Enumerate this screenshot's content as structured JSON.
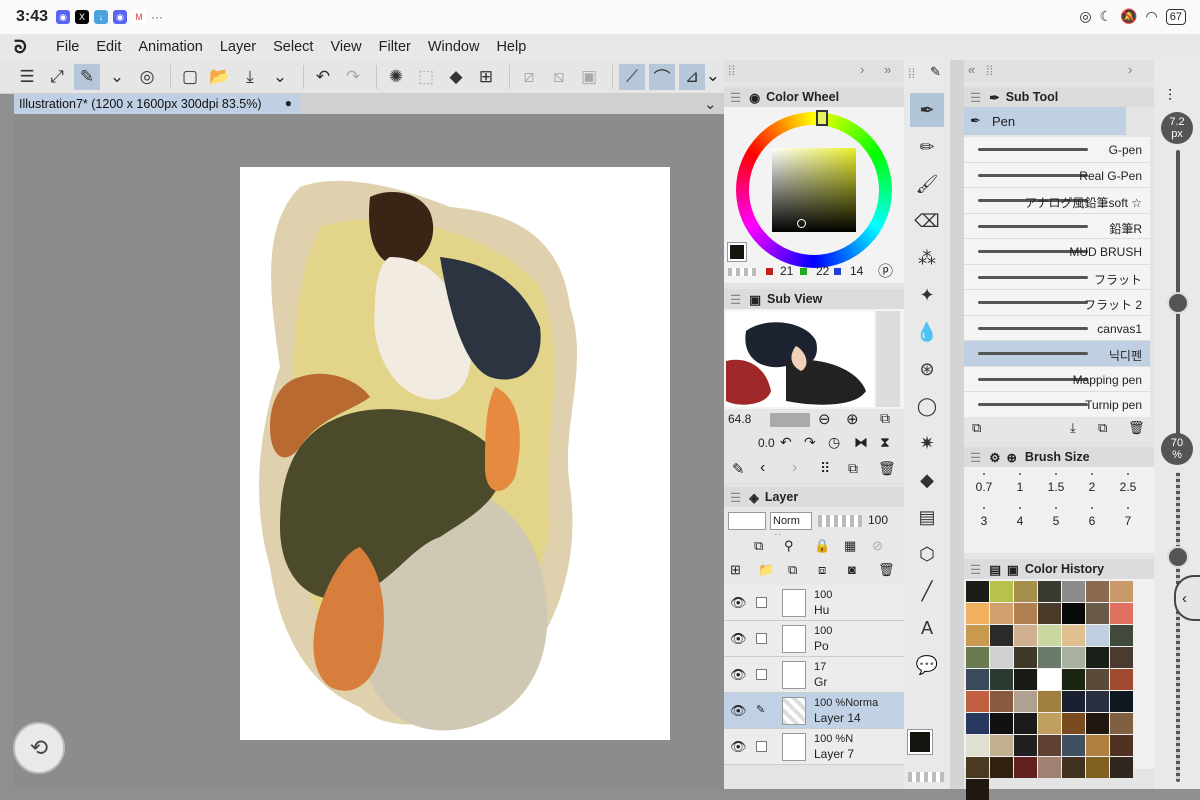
{
  "status": {
    "time": "3:43",
    "battery": "67"
  },
  "menu": [
    "File",
    "Edit",
    "Animation",
    "Layer",
    "Select",
    "View",
    "Filter",
    "Window",
    "Help"
  ],
  "document_tab": "Illustration7* (1200 x 1600px 300dpi 83.5%)",
  "color_wheel": {
    "title": "Color Wheel",
    "r": "21",
    "g": "22",
    "b": "14",
    "main_color": "#15150f"
  },
  "sub_view": {
    "title": "Sub View",
    "zoom": "64.8",
    "rotation": "0.0"
  },
  "layer_panel": {
    "title": "Layer",
    "blend_mode": "Norm",
    "opacity": "100",
    "layers": [
      {
        "line1": "100",
        "line2": "Hu"
      },
      {
        "line1": "100",
        "line2": "Po"
      },
      {
        "line1": "17",
        "line2": "Gr"
      },
      {
        "line1": "100 %Norma",
        "line2": "Layer 14"
      },
      {
        "line1": "100 %N",
        "line2": "Layer 7"
      }
    ]
  },
  "sub_tool": {
    "title": "Sub Tool",
    "group": "Pen",
    "brushes": [
      "G-pen",
      "Real G-Pen",
      "アナログ風鉛筆soft ☆",
      "鉛筆R",
      "MUD BRUSH",
      "フラット",
      "フラット 2",
      "canvas1",
      "닉디펜",
      "Mapping pen",
      "Turnip pen"
    ]
  },
  "brush_size": {
    "title": "Brush Size",
    "sizes": [
      "0.7",
      "1",
      "1.5",
      "2",
      "2.5",
      "3",
      "4",
      "5",
      "6",
      "7"
    ]
  },
  "color_history": {
    "title": "Color History",
    "colors": [
      "#1c1c18",
      "#b8c24a",
      "#a58f4b",
      "#3a3a30",
      "#8c8c8c",
      "#8a6a50",
      "#c89a6a",
      "#f0b060",
      "#d0a070",
      "#b08050",
      "#4a3a2a",
      "#0a0a0a",
      "#6a5a4a",
      "#e07060",
      "#c89a50",
      "#2a2a28",
      "#d0b090",
      "#c8d8a0",
      "#e0c090",
      "#c0d0e0",
      "#404a3a",
      "#6a7a50",
      "#d0d0d0",
      "#403828",
      "#6a7a6a",
      "#a8b0a0",
      "#1a2018",
      "#4a3a30",
      "#3a4a5a",
      "#2a3a30",
      "#1a1a14",
      "#ffffff",
      "#1a2410",
      "#5a4a3a",
      "#a04a30",
      "#c06040",
      "#8a5a40",
      "#b0a090",
      "#a08040",
      "#1a2030",
      "#2a3040",
      "#101820",
      "#283860",
      "#101010",
      "#1a1a1a",
      "#c0a060",
      "#7a4a20",
      "#201810",
      "#806040",
      "#e0e0d0",
      "#c0b090",
      "#202020",
      "#604030",
      "#405060",
      "#b08040",
      "#503020",
      "#4a3a20",
      "#302010",
      "#602020",
      "#a08070",
      "#403020",
      "#806020",
      "#302820",
      "#201810"
    ]
  },
  "right_sliders": {
    "size": "7.2",
    "size_unit": "px",
    "opacity": "70",
    "opacity_unit": "%"
  }
}
